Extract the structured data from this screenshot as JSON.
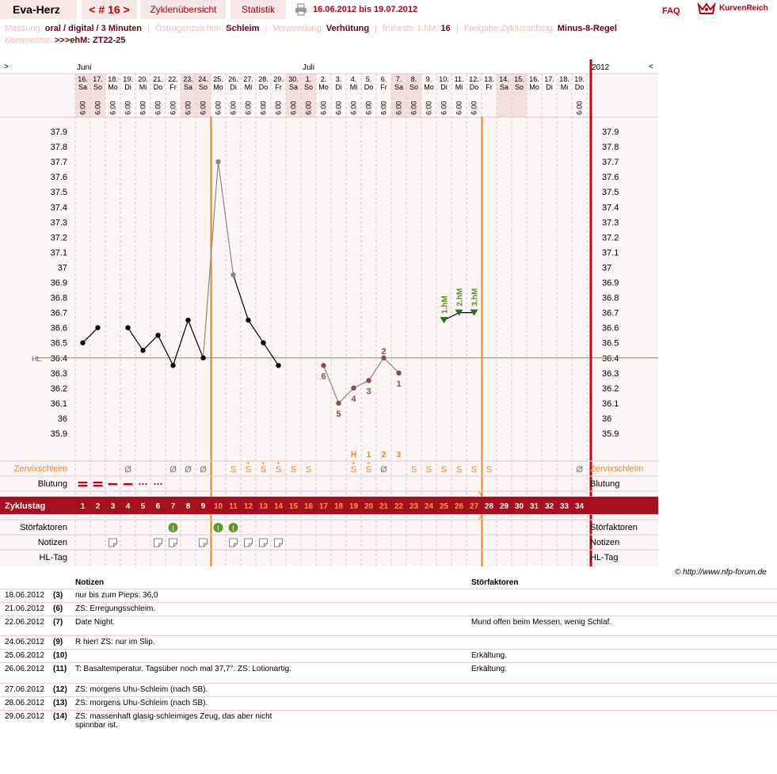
{
  "header": {
    "title": "Eva-Herz",
    "cycle": "< # 16 >",
    "tab_overview": "Zyklenübersicht",
    "tab_stats": "Statistik",
    "date_range": "16.06.2012 bis 19.07.2012",
    "faq": "FAQ",
    "logo_text": "KurvenReich"
  },
  "info": {
    "measure_label": "Messung:",
    "measure_value": "oral / digital / 3 Minuten",
    "estrogen_label": "Östrogenzeichen:",
    "estrogen_value": "Schleim",
    "use_label": "Verwendung:",
    "use_value": "Verhütung",
    "earliest_label": "früheste 1.hM:",
    "earliest_value": "16",
    "release_label": "Freigabe Zyklusanfang:",
    "release_value": "Minus-8-Regel",
    "comment_label": "Kommentar:",
    "comment_value": ">>>ehM: ZT22-25"
  },
  "chart_data": {
    "type": "line",
    "months": [
      "Juni",
      "Juli"
    ],
    "year_label": "2012",
    "nav_left": ">",
    "nav_right": "<",
    "dates": [
      "16.",
      "17.",
      "18.",
      "19.",
      "20.",
      "21.",
      "22.",
      "23.",
      "24.",
      "25.",
      "26.",
      "27.",
      "28.",
      "29.",
      "30.",
      "1.",
      "2.",
      "3.",
      "4.",
      "5.",
      "6.",
      "7.",
      "8.",
      "9.",
      "10.",
      "11.",
      "12.",
      "13.",
      "14.",
      "15.",
      "16.",
      "17.",
      "18.",
      "19."
    ],
    "weekdays": [
      "Sa",
      "So",
      "Mo",
      "Di",
      "Mi",
      "Do",
      "Fr",
      "Sa",
      "So",
      "Mo",
      "Di",
      "Mi",
      "Do",
      "Fr",
      "Sa",
      "So",
      "Mo",
      "Di",
      "Mi",
      "Do",
      "Fr",
      "Sa",
      "So",
      "Mo",
      "Di",
      "Mi",
      "Do",
      "Fr",
      "Sa",
      "So",
      "Mo",
      "Di",
      "Mi",
      "Do"
    ],
    "times": [
      "6:00",
      "6:00",
      "6:00",
      "6:00",
      "6:00",
      "6:00",
      "6:00",
      "6:00",
      "6:00",
      "6:00",
      "6:00",
      "6:00",
      "6:00",
      "6:00",
      "6:00",
      "6:00",
      "6:00",
      "6:00",
      "6:00",
      "6:00",
      "6:00",
      "6:00",
      "6:00",
      "6:00",
      "6:00",
      "6:00",
      "6:00",
      "",
      "",
      "",
      "",
      "",
      "",
      "6:00"
    ],
    "weekend": [
      true,
      true,
      false,
      false,
      false,
      false,
      false,
      true,
      true,
      false,
      false,
      false,
      false,
      false,
      true,
      true,
      false,
      false,
      false,
      false,
      false,
      true,
      true,
      false,
      false,
      false,
      false,
      false,
      true,
      true,
      false,
      false,
      false,
      false
    ],
    "y_ticks": [
      "37.9",
      "37.8",
      "37.7",
      "37.6",
      "37.5",
      "37.4",
      "37.3",
      "37.2",
      "37.1",
      "37",
      "36.9",
      "36.8",
      "36.7",
      "36.6",
      "36.5",
      "36.4",
      "36.3",
      "36.2",
      "36.1",
      "36",
      "35.9"
    ],
    "ylim": [
      35.9,
      37.9
    ],
    "hl_label": "HL:",
    "hl_value": 36.4,
    "temps": [
      36.5,
      36.6,
      null,
      36.6,
      36.45,
      36.55,
      36.35,
      36.65,
      36.4,
      37.7,
      36.95,
      36.65,
      36.5,
      36.35,
      null,
      null,
      36.35,
      36.1,
      36.2,
      36.25,
      36.4,
      36.3,
      null,
      null,
      null,
      null,
      null,
      null,
      null,
      null,
      null,
      null,
      null,
      null
    ],
    "temp_gray": [
      9,
      10,
      16,
      17,
      18,
      19,
      20,
      21
    ],
    "low_labels": [
      {
        "day": 16,
        "text": "6"
      },
      {
        "day": 17,
        "text": "5"
      },
      {
        "day": 18,
        "text": "4"
      },
      {
        "day": 19,
        "text": "3"
      },
      {
        "day": 20,
        "text": "2"
      },
      {
        "day": 21,
        "text": "1"
      }
    ],
    "hm": [
      {
        "day": 24,
        "value": 36.65,
        "label": "1.hM"
      },
      {
        "day": 25,
        "value": 36.7,
        "label": "2.hM"
      },
      {
        "day": 26,
        "value": 36.7,
        "label": "3.hM"
      }
    ],
    "peak_row": [
      {
        "day": 18,
        "text": "H"
      },
      {
        "day": 19,
        "text": "1"
      },
      {
        "day": 20,
        "text": "2"
      },
      {
        "day": 21,
        "text": "3"
      }
    ],
    "mucus_label": "Zervixschleim",
    "mucus": [
      "",
      "",
      "",
      "Ø",
      "",
      "",
      "Ø",
      "Ø",
      "Ø",
      "",
      "S",
      "S+",
      "S+",
      "S+",
      "S",
      "S",
      "",
      "",
      "S+",
      "S+",
      "Ø",
      "",
      "S",
      "S",
      "S",
      "S",
      "S",
      "S",
      "",
      "",
      "",
      "",
      "",
      "Ø"
    ],
    "mucus_color": [
      "",
      "",
      "",
      "gray",
      "",
      "",
      "gray",
      "gray",
      "gray",
      "",
      "orange",
      "orange",
      "orange",
      "orange",
      "orange",
      "orange",
      "",
      "",
      "orange",
      "orange",
      "gray",
      "",
      "orange",
      "orange",
      "orange",
      "orange",
      "orange",
      "orange",
      "",
      "",
      "",
      "",
      "",
      "gray"
    ],
    "bleeding_label": "Blutung",
    "bleeding": [
      2,
      2,
      1.5,
      1,
      0.6,
      0.6,
      0,
      0,
      0,
      0,
      0,
      0,
      0,
      0,
      0,
      0,
      0,
      0,
      0,
      0,
      0,
      0,
      0,
      0,
      0,
      0,
      0,
      0,
      0,
      0,
      0,
      0,
      0,
      0
    ],
    "cycle_label": "Zyklustag",
    "cycle_days": [
      "1",
      "2",
      "3",
      "4",
      "5",
      "6",
      "7",
      "8",
      "9",
      "10",
      "11",
      "12",
      "13",
      "14",
      "15",
      "16",
      "17",
      "18",
      "19",
      "20",
      "21",
      "22",
      "23",
      "24",
      "25",
      "26",
      "27",
      "28",
      "29",
      "30",
      "31",
      "32",
      "33",
      "34"
    ],
    "cycle_highlight_from": 9,
    "cycle_highlight_to": 26,
    "disturb_label": "Störfaktoren",
    "disturb_days": [
      6,
      9,
      10
    ],
    "notes_label": "Notizen",
    "notes_days": [
      2,
      5,
      6,
      8,
      10,
      11,
      12,
      13
    ],
    "hl_day_label": "HL-Tag",
    "coverline_days": [
      8,
      26
    ]
  },
  "credit": "© http://www.nfp-forum.de",
  "notes_table": {
    "header_notes": "Notizen",
    "header_factors": "Störfaktoren",
    "rows": [
      {
        "date": "18.06.2012",
        "cd": "(3)",
        "note": "nur bis zum Pieps: 36,0",
        "factor": ""
      },
      {
        "date": "21.06.2012",
        "cd": "(6)",
        "note": "ZS: Erregungsschleim.",
        "factor": ""
      },
      {
        "date": "22.06.2012",
        "cd": "(7)",
        "note": "Date Night.",
        "factor": "Mund offen beim Messen, wenig Schlaf."
      },
      {
        "date": "24.06.2012",
        "cd": "(9)",
        "note": "R hier! ZS: nur im Slip.",
        "factor": ""
      },
      {
        "date": "25.06.2012",
        "cd": "(10)",
        "note": "",
        "factor": "Erkältung."
      },
      {
        "date": "26.06.2012",
        "cd": "(11)",
        "note": "T: Basaltemperatur. Tagsüber noch mal 37,7°. ZS: Lotionartig.",
        "factor": "Erkältung."
      },
      {
        "date": "27.06.2012",
        "cd": "(12)",
        "note": "ZS: morgens Uhu-Schleim (nach SB).",
        "factor": ""
      },
      {
        "date": "28.06.2012",
        "cd": "(13)",
        "note": "ZS: morgens Uhu-Schleim (nach SB).",
        "factor": ""
      },
      {
        "date": "29.06.2012",
        "cd": "(14)",
        "note": "ZS: massenhaft glasig-schleimiges Zeug, das aber nicht spinnbar ist.",
        "factor": ""
      }
    ]
  }
}
